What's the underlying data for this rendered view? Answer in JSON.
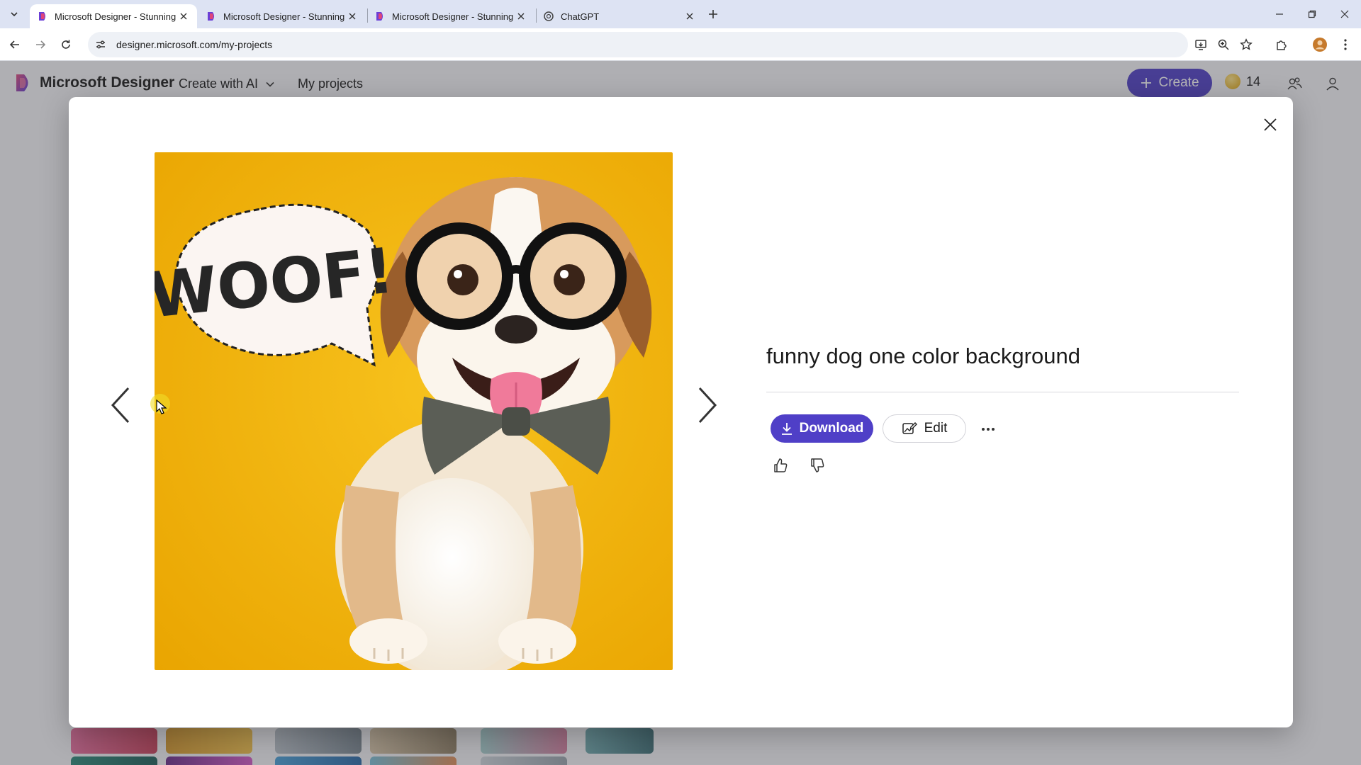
{
  "browser": {
    "tabs": [
      {
        "title": "Microsoft Designer - Stunning designs in a flash",
        "active": true,
        "icon": "designer-favicon"
      },
      {
        "title": "Microsoft Designer - Stunning designs in a flash",
        "active": false,
        "icon": "designer-favicon"
      },
      {
        "title": "Microsoft Designer - Stunning designs in a flash",
        "active": false,
        "icon": "designer-favicon"
      },
      {
        "title": "ChatGPT",
        "active": false,
        "icon": "chatgpt-favicon"
      }
    ],
    "url": "designer.microsoft.com/my-projects"
  },
  "app": {
    "brand": "Microsoft Designer",
    "nav": {
      "create_with_ai": "Create with AI",
      "my_projects": "My projects"
    },
    "create_label": "Create",
    "coins": "14",
    "accent": "#4f3fc7"
  },
  "modal": {
    "prompt": "funny dog one color background",
    "download_label": "Download",
    "edit_label": "Edit",
    "image": {
      "speech_text": "WOOF!",
      "background_color": "#f2b400"
    }
  }
}
